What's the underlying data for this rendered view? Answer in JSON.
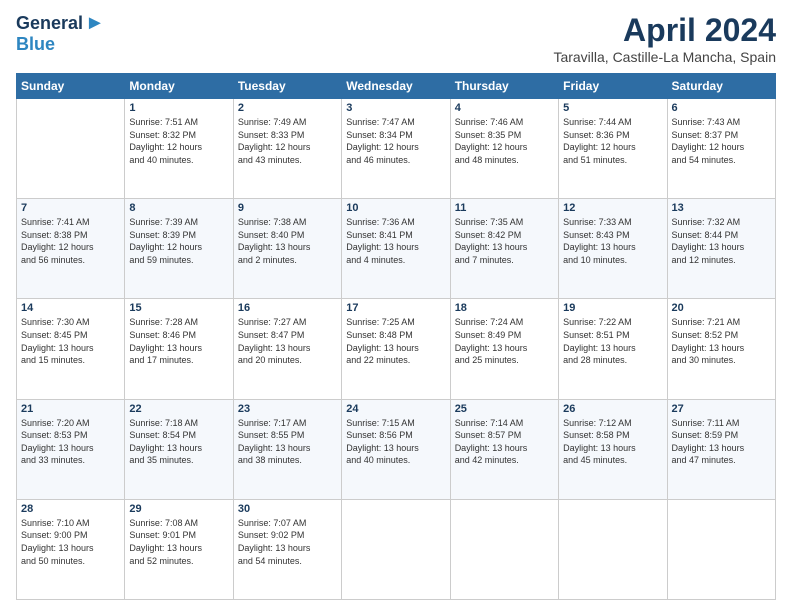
{
  "logo": {
    "line1": "General",
    "line2": "Blue"
  },
  "title": "April 2024",
  "subtitle": "Taravilla, Castille-La Mancha, Spain",
  "headers": [
    "Sunday",
    "Monday",
    "Tuesday",
    "Wednesday",
    "Thursday",
    "Friday",
    "Saturday"
  ],
  "weeks": [
    [
      {
        "day": "",
        "info": ""
      },
      {
        "day": "1",
        "info": "Sunrise: 7:51 AM\nSunset: 8:32 PM\nDaylight: 12 hours\nand 40 minutes."
      },
      {
        "day": "2",
        "info": "Sunrise: 7:49 AM\nSunset: 8:33 PM\nDaylight: 12 hours\nand 43 minutes."
      },
      {
        "day": "3",
        "info": "Sunrise: 7:47 AM\nSunset: 8:34 PM\nDaylight: 12 hours\nand 46 minutes."
      },
      {
        "day": "4",
        "info": "Sunrise: 7:46 AM\nSunset: 8:35 PM\nDaylight: 12 hours\nand 48 minutes."
      },
      {
        "day": "5",
        "info": "Sunrise: 7:44 AM\nSunset: 8:36 PM\nDaylight: 12 hours\nand 51 minutes."
      },
      {
        "day": "6",
        "info": "Sunrise: 7:43 AM\nSunset: 8:37 PM\nDaylight: 12 hours\nand 54 minutes."
      }
    ],
    [
      {
        "day": "7",
        "info": "Sunrise: 7:41 AM\nSunset: 8:38 PM\nDaylight: 12 hours\nand 56 minutes."
      },
      {
        "day": "8",
        "info": "Sunrise: 7:39 AM\nSunset: 8:39 PM\nDaylight: 12 hours\nand 59 minutes."
      },
      {
        "day": "9",
        "info": "Sunrise: 7:38 AM\nSunset: 8:40 PM\nDaylight: 13 hours\nand 2 minutes."
      },
      {
        "day": "10",
        "info": "Sunrise: 7:36 AM\nSunset: 8:41 PM\nDaylight: 13 hours\nand 4 minutes."
      },
      {
        "day": "11",
        "info": "Sunrise: 7:35 AM\nSunset: 8:42 PM\nDaylight: 13 hours\nand 7 minutes."
      },
      {
        "day": "12",
        "info": "Sunrise: 7:33 AM\nSunset: 8:43 PM\nDaylight: 13 hours\nand 10 minutes."
      },
      {
        "day": "13",
        "info": "Sunrise: 7:32 AM\nSunset: 8:44 PM\nDaylight: 13 hours\nand 12 minutes."
      }
    ],
    [
      {
        "day": "14",
        "info": "Sunrise: 7:30 AM\nSunset: 8:45 PM\nDaylight: 13 hours\nand 15 minutes."
      },
      {
        "day": "15",
        "info": "Sunrise: 7:28 AM\nSunset: 8:46 PM\nDaylight: 13 hours\nand 17 minutes."
      },
      {
        "day": "16",
        "info": "Sunrise: 7:27 AM\nSunset: 8:47 PM\nDaylight: 13 hours\nand 20 minutes."
      },
      {
        "day": "17",
        "info": "Sunrise: 7:25 AM\nSunset: 8:48 PM\nDaylight: 13 hours\nand 22 minutes."
      },
      {
        "day": "18",
        "info": "Sunrise: 7:24 AM\nSunset: 8:49 PM\nDaylight: 13 hours\nand 25 minutes."
      },
      {
        "day": "19",
        "info": "Sunrise: 7:22 AM\nSunset: 8:51 PM\nDaylight: 13 hours\nand 28 minutes."
      },
      {
        "day": "20",
        "info": "Sunrise: 7:21 AM\nSunset: 8:52 PM\nDaylight: 13 hours\nand 30 minutes."
      }
    ],
    [
      {
        "day": "21",
        "info": "Sunrise: 7:20 AM\nSunset: 8:53 PM\nDaylight: 13 hours\nand 33 minutes."
      },
      {
        "day": "22",
        "info": "Sunrise: 7:18 AM\nSunset: 8:54 PM\nDaylight: 13 hours\nand 35 minutes."
      },
      {
        "day": "23",
        "info": "Sunrise: 7:17 AM\nSunset: 8:55 PM\nDaylight: 13 hours\nand 38 minutes."
      },
      {
        "day": "24",
        "info": "Sunrise: 7:15 AM\nSunset: 8:56 PM\nDaylight: 13 hours\nand 40 minutes."
      },
      {
        "day": "25",
        "info": "Sunrise: 7:14 AM\nSunset: 8:57 PM\nDaylight: 13 hours\nand 42 minutes."
      },
      {
        "day": "26",
        "info": "Sunrise: 7:12 AM\nSunset: 8:58 PM\nDaylight: 13 hours\nand 45 minutes."
      },
      {
        "day": "27",
        "info": "Sunrise: 7:11 AM\nSunset: 8:59 PM\nDaylight: 13 hours\nand 47 minutes."
      }
    ],
    [
      {
        "day": "28",
        "info": "Sunrise: 7:10 AM\nSunset: 9:00 PM\nDaylight: 13 hours\nand 50 minutes."
      },
      {
        "day": "29",
        "info": "Sunrise: 7:08 AM\nSunset: 9:01 PM\nDaylight: 13 hours\nand 52 minutes."
      },
      {
        "day": "30",
        "info": "Sunrise: 7:07 AM\nSunset: 9:02 PM\nDaylight: 13 hours\nand 54 minutes."
      },
      {
        "day": "",
        "info": ""
      },
      {
        "day": "",
        "info": ""
      },
      {
        "day": "",
        "info": ""
      },
      {
        "day": "",
        "info": ""
      }
    ]
  ]
}
